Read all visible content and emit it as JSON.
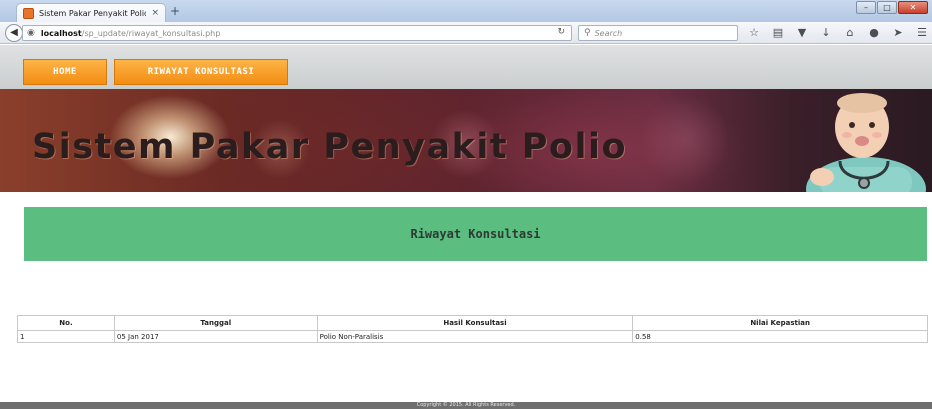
{
  "browser": {
    "tab_title": "Sistem Pakar Penyakit Polio",
    "tab_close": "×",
    "new_tab": "+",
    "url_host": "localhost",
    "url_path": "/sp_update/riwayat_konsultasi.php",
    "search_placeholder": "Search",
    "window_buttons": {
      "minimize": "–",
      "maximize": "□",
      "close": "✕"
    }
  },
  "nav": {
    "home_label": "HOME",
    "riwayat_label": "RIWAYAT KONSULTASI"
  },
  "banner": {
    "title": "Sistem Pakar Penyakit Polio"
  },
  "section": {
    "title": "Riwayat Konsultasi"
  },
  "table": {
    "headers": [
      "No.",
      "Tanggal",
      "Hasil Konsultasi",
      "Nilai Kepastian"
    ],
    "rows": [
      [
        "1",
        "05 Jan 2017",
        "Polio Non-Paralisis",
        "0.58"
      ]
    ]
  },
  "footer": {
    "text": "Copyright © 2015. All Rights Reserved."
  },
  "colors": {
    "menu_orange": "#f7a42c",
    "section_green": "#5bbd80",
    "footer_gray": "#6f6f6f"
  }
}
